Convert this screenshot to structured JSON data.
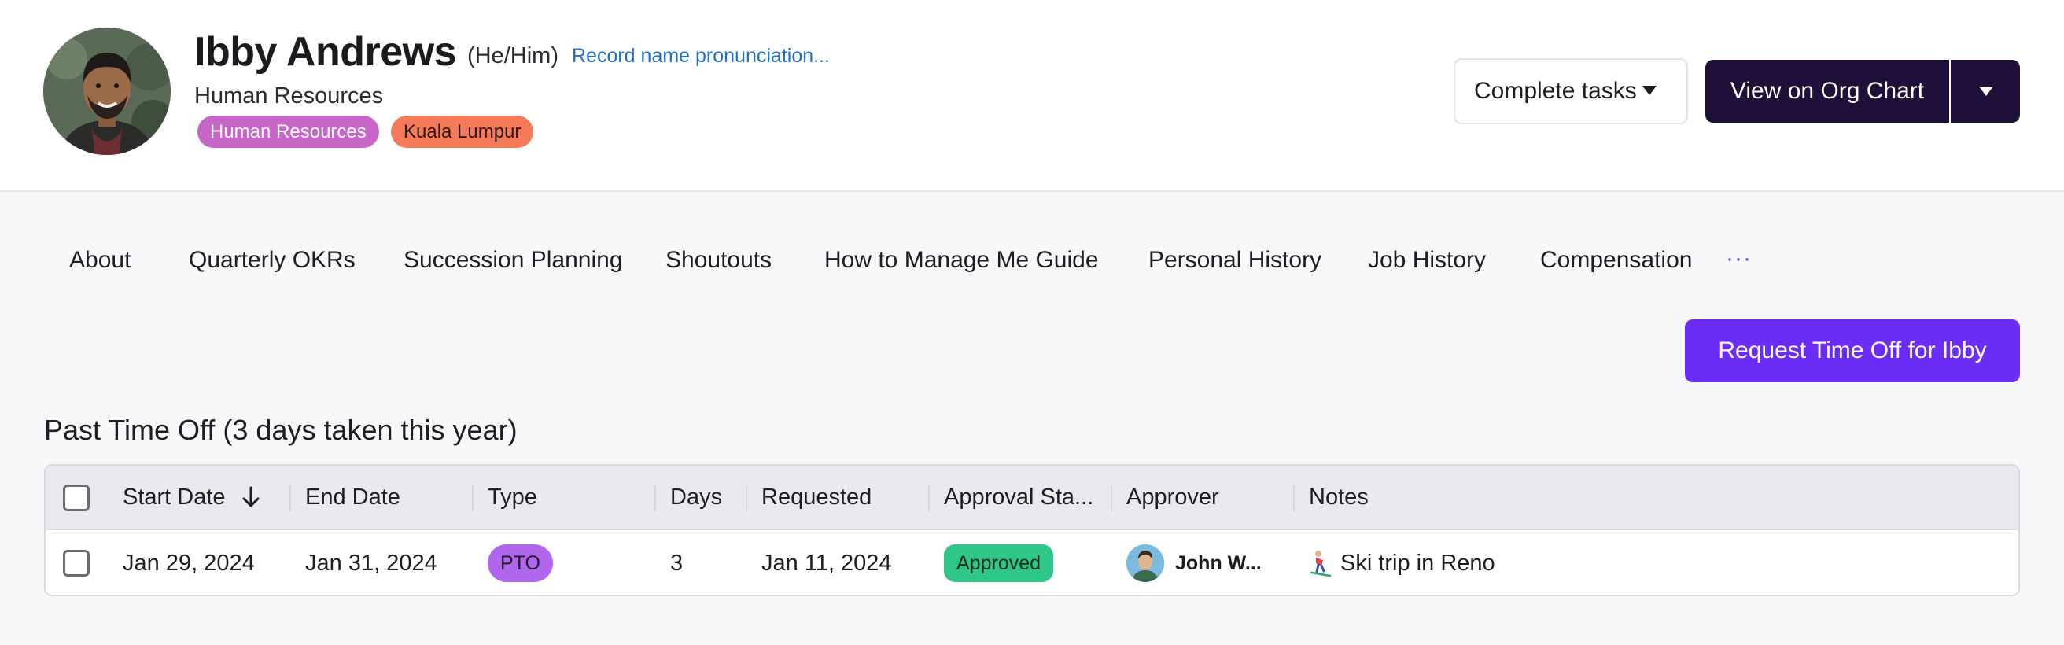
{
  "profile": {
    "name": "Ibby Andrews",
    "pronouns": "(He/Him)",
    "pronunciation_link": "Record name pronunciation...",
    "department": "Human Resources",
    "tags": [
      "Human Resources",
      "Kuala Lumpur"
    ]
  },
  "actions": {
    "complete_tasks": "Complete tasks",
    "view_org_chart": "View on Org Chart",
    "request_time_off": "Request Time Off for Ibby"
  },
  "tabs": [
    "About",
    "Quarterly OKRs",
    "Succession Planning",
    "Shoutouts",
    "How to Manage Me Guide",
    "Personal History",
    "Job History",
    "Compensation"
  ],
  "tabs_more": "···",
  "section_title": "Past Time Off (3 days taken this year)",
  "table": {
    "columns": [
      "Start Date",
      "End Date",
      "Type",
      "Days",
      "Requested",
      "Approval Sta...",
      "Approver",
      "Notes"
    ],
    "sort": {
      "column": "Start Date",
      "direction": "descending"
    },
    "rows": [
      {
        "start_date": "Jan 29, 2024",
        "end_date": "Jan 31, 2024",
        "type": "PTO",
        "days": "3",
        "requested": "Jan 11, 2024",
        "approval_status": "Approved",
        "approver": "John W...",
        "notes": "Ski trip in Reno"
      }
    ]
  },
  "colors": {
    "primary": "#6b2cf5",
    "dark_button": "#1e1038",
    "tag_department": "#c566c8",
    "tag_location": "#f47a5a",
    "status_approved": "#2fc68a",
    "type_pto": "#b067ee",
    "link": "#1f6fc2"
  },
  "icons": {
    "avatar": "person-photo",
    "complete_caret": "caret-down-icon",
    "org_caret": "caret-down-icon",
    "sort": "arrow-down-icon",
    "notes": "skier-icon"
  }
}
